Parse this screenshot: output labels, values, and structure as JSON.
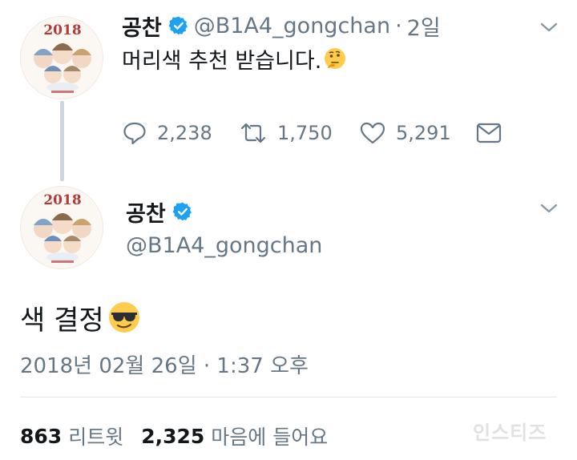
{
  "tweet1": {
    "name": "공찬",
    "handle": "@B1A4_gongchan",
    "dot": "·",
    "time": "2일",
    "text": "머리색 추천 받습니다.",
    "emoji": "thinking-face-emoji",
    "avatar_caption": "2018",
    "actions": {
      "replies": "2,238",
      "retweets": "1,750",
      "likes": "5,291"
    }
  },
  "tweet2": {
    "name": "공찬",
    "handle": "@B1A4_gongchan",
    "text": "색 결정",
    "emoji": "sunglasses-face-emoji",
    "avatar_caption": "2018",
    "date": "2018년 02월 26일 · 1:37 오후",
    "stats": {
      "retweet_count": "863",
      "retweet_label": "리트윗",
      "like_count": "2,325",
      "like_label": "마음에 들어요"
    }
  },
  "watermark": "인스티즈",
  "colors": {
    "text": "#14171a",
    "secondary": "#657786",
    "verified": "#1da1f2",
    "thread_line": "#ccd6dd",
    "divider": "#e1e8ed"
  },
  "icons": [
    "verified-badge-icon",
    "chevron-down-icon",
    "reply-icon",
    "retweet-icon",
    "like-icon",
    "direct-message-icon"
  ]
}
